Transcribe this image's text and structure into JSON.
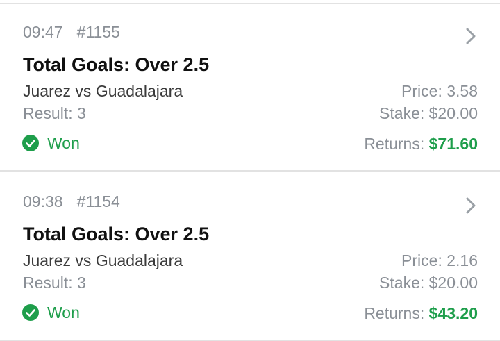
{
  "colors": {
    "won_green": "#1e9e4b",
    "muted_text": "#8a8f96",
    "divider": "#e2e2e2"
  },
  "bets": [
    {
      "time": "09:47",
      "bet_id": "#1155",
      "market": "Total Goals: Over 2.5",
      "event": "Juarez vs Guadalajara",
      "result": "Result: 3",
      "price": "Price: 3.58",
      "stake": "Stake: $20.00",
      "returns_label": "Returns: ",
      "returns_value": "$71.60",
      "status": "Won",
      "status_icon": "check-circle-icon",
      "nav_icon": "chevron-right-icon"
    },
    {
      "time": "09:38",
      "bet_id": "#1154",
      "market": "Total Goals: Over 2.5",
      "event": "Juarez vs Guadalajara",
      "result": "Result: 3",
      "price": "Price: 2.16",
      "stake": "Stake: $20.00",
      "returns_label": "Returns: ",
      "returns_value": "$43.20",
      "status": "Won",
      "status_icon": "check-circle-icon",
      "nav_icon": "chevron-right-icon"
    }
  ]
}
